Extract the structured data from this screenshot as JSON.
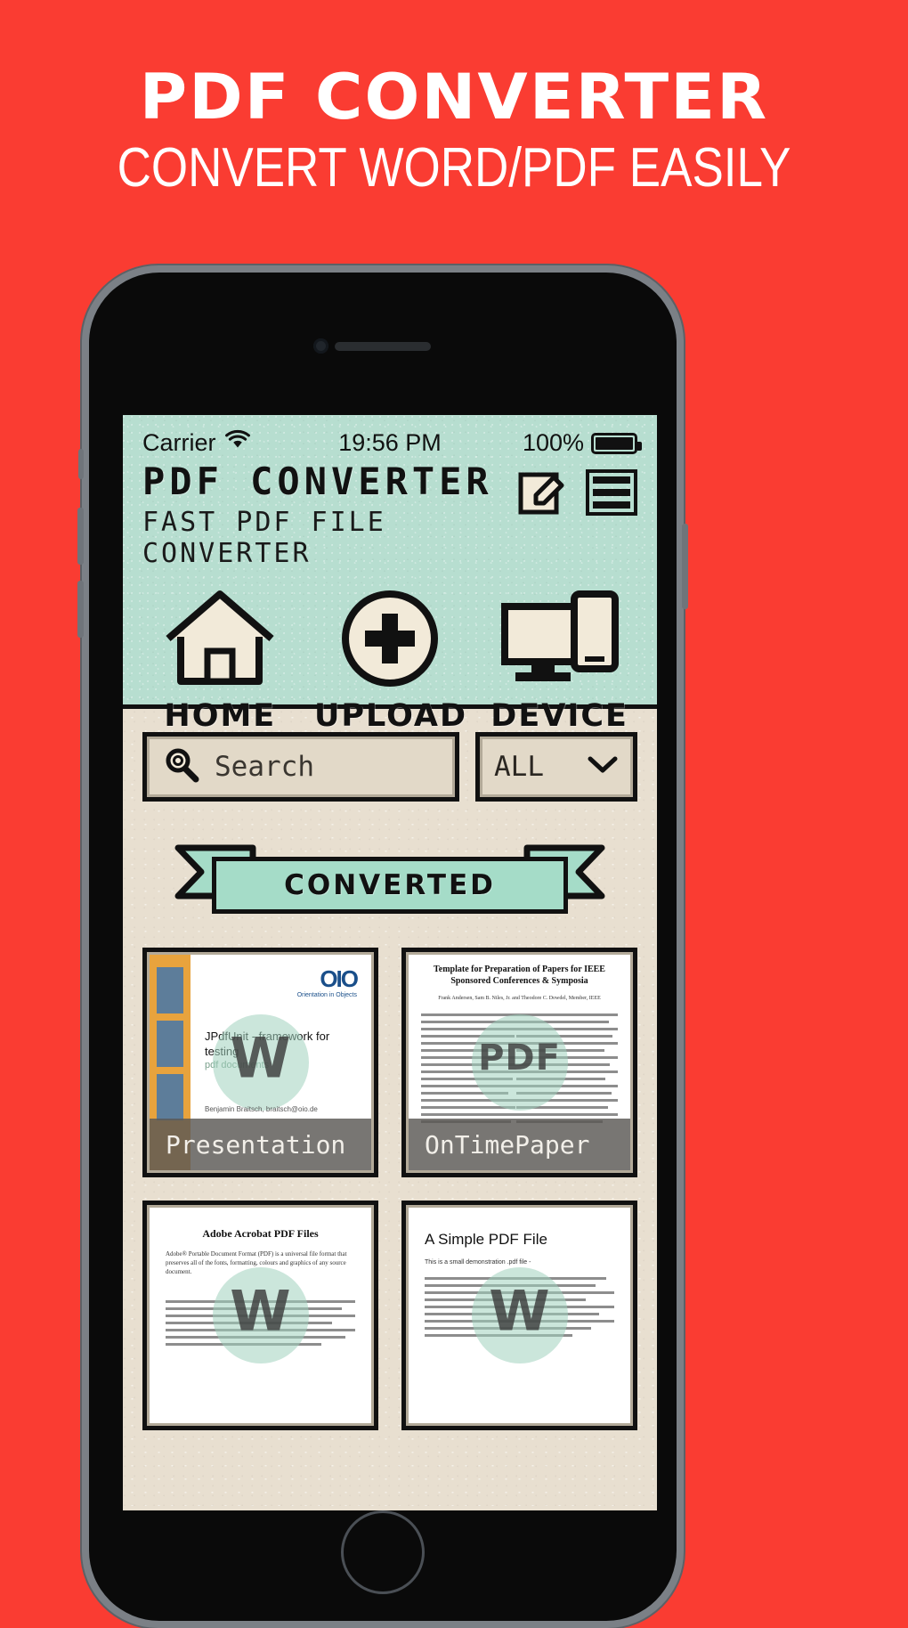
{
  "promo": {
    "title": "PDF CONVERTER",
    "subtitle": "CONVERT WORD/PDF EASILY",
    "background_color": "#fa3c32",
    "text_color": "#ffffff"
  },
  "statusbar": {
    "carrier": "Carrier",
    "wifi_icon": "wifi-icon",
    "time": "19:56 PM",
    "battery_percent": "100%",
    "battery_icon": "battery-full-icon"
  },
  "app": {
    "title": "PDF CONVERTER",
    "subtitle": "FAST PDF FILE CONVERTER",
    "header_color": "#b7ded0",
    "body_color": "#e8dfd0",
    "icons": [
      {
        "name": "edit-icon",
        "label": "Edit"
      },
      {
        "name": "menu-icon",
        "label": "Menu"
      }
    ]
  },
  "nav": {
    "items": [
      {
        "label": "HOME",
        "icon": "home-icon"
      },
      {
        "label": "UPLOAD",
        "icon": "upload-plus-icon"
      },
      {
        "label": "DEVICE",
        "icon": "device-icon"
      }
    ]
  },
  "search": {
    "placeholder": "Search",
    "value": "",
    "icon": "search-icon"
  },
  "filter": {
    "selected": "ALL",
    "icon": "chevron-down-icon",
    "options": [
      "ALL"
    ]
  },
  "ribbon": {
    "label": "CONVERTED",
    "color": "#a5dcc8"
  },
  "documents": [
    {
      "caption": "Presentation",
      "heading": "JPdfUnit - framework for testing",
      "subheading": "pdf documents",
      "logo": "Orientation in Objects",
      "footer": "Benjamin Braitsch, braitsch@oio.de",
      "watermark": "W"
    },
    {
      "caption": "OnTimePaper",
      "heading": "Template for Preparation of Papers for IEEE Sponsored Conferences & Symposia",
      "subheading": "Frank Andersen, Sam B. Niles, Jr. and Theodore C. Dowdel, Member, IEEE",
      "watermark": "PDF"
    },
    {
      "caption": "",
      "heading": "Adobe Acrobat PDF Files",
      "subheading": "Adobe® Portable Document Format (PDF) is a universal file format that preserves all of the fonts, formatting, colours and graphics of any source document.",
      "watermark": "W"
    },
    {
      "caption": "",
      "heading": "A Simple PDF File",
      "subheading": "This is a small demonstration .pdf file -",
      "watermark": "W"
    }
  ]
}
